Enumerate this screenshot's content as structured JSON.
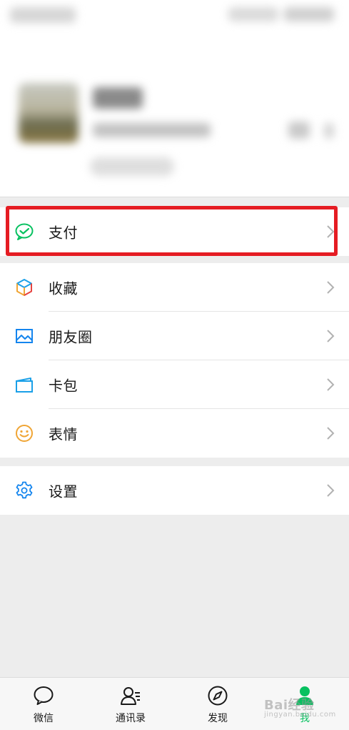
{
  "menu": {
    "pay": "支付",
    "favorites": "收藏",
    "moments": "朋友圈",
    "cards": "卡包",
    "stickers": "表情",
    "settings": "设置"
  },
  "tabs": [
    {
      "label": "微信",
      "icon": "chat-bubble-icon"
    },
    {
      "label": "通讯录",
      "icon": "contacts-icon"
    },
    {
      "label": "发现",
      "icon": "compass-icon"
    },
    {
      "label": "我",
      "icon": "person-icon",
      "active": true
    }
  ],
  "watermark": {
    "text": "Bai经验",
    "sub": "jingyan.baidu.com"
  },
  "colors": {
    "accent": "#07c160",
    "highlight": "#e51c23",
    "moments_blue": "#1485ee",
    "stickers_orange": "#f0a535"
  }
}
